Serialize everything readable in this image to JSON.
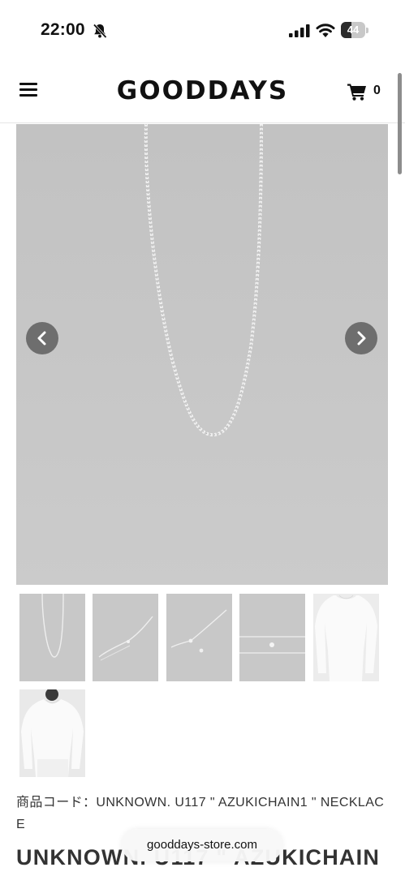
{
  "status_bar": {
    "time": "22:00",
    "battery_level": "44",
    "battery_fraction": 0.44,
    "icons": [
      "bell-slash-icon",
      "signal-icon",
      "wifi-icon",
      "battery-icon"
    ]
  },
  "header": {
    "logo": "GOODDAYS",
    "cart_count": "0",
    "menu_icon": "hamburger-icon",
    "cart_icon": "cart-icon"
  },
  "gallery": {
    "prev_icon": "chevron-left-icon",
    "next_icon": "chevron-right-icon",
    "thumbnail_count": 6
  },
  "product": {
    "code_line": "商品コード：UNKNOWN. U117 \" AZUKICHAIN1 \" NECKLACE",
    "title": "UNKNOWN. U117 \" AZUKICHAIN"
  },
  "browser": {
    "url": "gooddays-store.com"
  },
  "colors": {
    "image_background": "#c5c5c5",
    "arrow_background": "#6e6e6e",
    "text": "#111111"
  }
}
